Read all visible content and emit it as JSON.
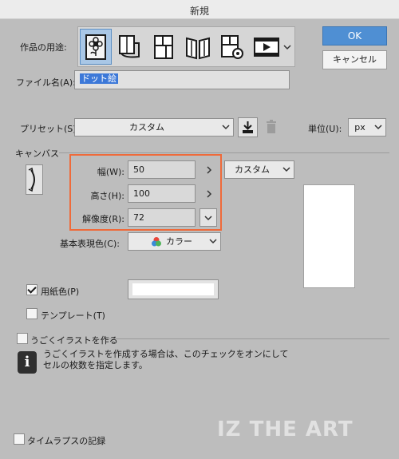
{
  "window": {
    "title": "新規"
  },
  "usage": {
    "label": "作品の用途:",
    "icons": [
      "illustration-icon",
      "webtoon-icon",
      "comic-icon",
      "book-icon",
      "print-icon",
      "animation-icon"
    ],
    "selected_index": 0
  },
  "buttons": {
    "ok": "OK",
    "cancel": "キャンセル"
  },
  "filename": {
    "label": "ファイル名(A):",
    "value": "ドット絵"
  },
  "preset": {
    "label": "プリセット(S):",
    "value": "カスタム"
  },
  "unit": {
    "label": "単位(U):",
    "value": "px"
  },
  "canvas": {
    "section_label": "キャンバス",
    "width": {
      "label": "幅(W):",
      "value": "50"
    },
    "height": {
      "label": "高さ(H):",
      "value": "100"
    },
    "resolution": {
      "label": "解像度(R):",
      "value": "72"
    },
    "size_preset": "カスタム",
    "color_mode": {
      "label": "基本表現色(C):",
      "value": "カラー"
    }
  },
  "paper": {
    "label": "用紙色(P)",
    "checked": true
  },
  "template": {
    "label": "テンプレート(T)",
    "checked": false
  },
  "animation": {
    "label": "うごくイラストを作る",
    "checked": false,
    "info": [
      "うごくイラストを作成する場合は、このチェックをオンにして",
      "セルの枚数を指定します。"
    ]
  },
  "timelapse": {
    "label": "タイムラプスの記録",
    "checked": false
  },
  "watermark": "IZ THE ART",
  "colors": {
    "highlight": "#ef6a3a",
    "ok_button": "#4f8fd3",
    "selected_icon_bg": "#a9c7e6"
  }
}
